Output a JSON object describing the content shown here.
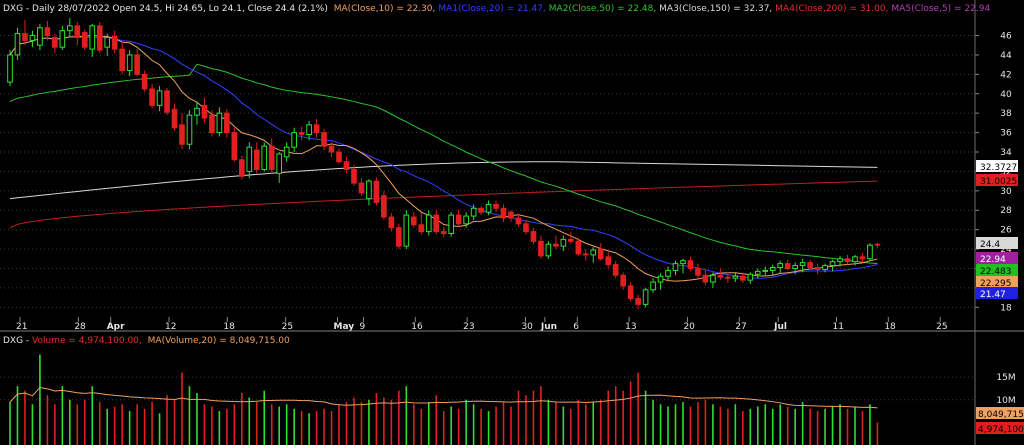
{
  "price_header": {
    "ticker_line": "DXG - Daily 28/07/2022 Open 24.5, Hi 24.65, Lo 24.1, Close 24.4 (2.1%)",
    "ma_items": [
      {
        "text": "MA(Close,10) = 22.30,",
        "color": "#f0a060"
      },
      {
        "text": "MA1(Close,20) = 21.47,",
        "color": "#3340ff"
      },
      {
        "text": "MA2(Close,50) = 22.48,",
        "color": "#30c030"
      },
      {
        "text": "MA3(Close,150) = 32.37,",
        "color": "#d8d8d8"
      },
      {
        "text": "MA4(Close,200) = 31.00,",
        "color": "#e03030"
      },
      {
        "text": "MA5(Close,5) = 22.94",
        "color": "#b040b0"
      }
    ]
  },
  "volume_header": {
    "ticker": "DXG - ",
    "volume_text": "Volume = 4,974,100.00,",
    "ma_text": "MA(Volume,20) = 8,049,715.00"
  },
  "price_axis": {
    "ticks": [
      "46",
      "44",
      "42",
      "40",
      "38",
      "36",
      "34",
      "32",
      "30",
      "28",
      "26",
      "24",
      "22",
      "20",
      "18"
    ],
    "tags": [
      {
        "text": "32.3727",
        "bg": "#ffffff",
        "fg": "#000000"
      },
      {
        "text": "31.0025",
        "bg": "#e02020",
        "fg": "#000000"
      },
      {
        "text": "24.4",
        "bg": "#d9d9d9",
        "fg": "#000000"
      },
      {
        "text": "22.94",
        "bg": "#a020a0",
        "fg": "#ffffff"
      },
      {
        "text": "22.483",
        "bg": "#20c020",
        "fg": "#000000"
      },
      {
        "text": "22.295",
        "bg": "#f0a060",
        "fg": "#000000"
      },
      {
        "text": "21.47",
        "bg": "#2020e0",
        "fg": "#ffffff"
      }
    ]
  },
  "volume_axis": {
    "ticks": [
      "15M",
      "10M"
    ],
    "tags": [
      {
        "text": "8,049,715",
        "bg": "#f0a060",
        "fg": "#000000"
      },
      {
        "text": "4,974,100",
        "bg": "#e02020",
        "fg": "#000000"
      }
    ]
  },
  "x_axis": {
    "labels": [
      {
        "text": "21",
        "month": false
      },
      {
        "text": "28",
        "month": false
      },
      {
        "text": "Apr",
        "month": true
      },
      {
        "text": "12",
        "month": false
      },
      {
        "text": "18",
        "month": false
      },
      {
        "text": "25",
        "month": false
      },
      {
        "text": "May",
        "month": true
      },
      {
        "text": "9",
        "month": false
      },
      {
        "text": "16",
        "month": false
      },
      {
        "text": "23",
        "month": false
      },
      {
        "text": "30",
        "month": false
      },
      {
        "text": "Jun",
        "month": true
      },
      {
        "text": "6",
        "month": false
      },
      {
        "text": "13",
        "month": false
      },
      {
        "text": "20",
        "month": false
      },
      {
        "text": "27",
        "month": false
      },
      {
        "text": "Jul",
        "month": true
      },
      {
        "text": "11",
        "month": false
      },
      {
        "text": "18",
        "month": false
      },
      {
        "text": "25",
        "month": false
      }
    ]
  },
  "colors": {
    "background": "#000000",
    "up": "#30e030",
    "down": "#e02020",
    "grid": "#3a3a3a",
    "ma10": "#f0a060",
    "ma20": "#3340ff",
    "ma50": "#30c030",
    "ma150": "#d8d8d8",
    "ma200": "#c02020",
    "volume_ma": "#f0a060"
  },
  "chart_data": {
    "type": "candlestick",
    "ticker": "DXG",
    "ylim": [
      17,
      47.6
    ],
    "volume_ylim": [
      0,
      21000000
    ],
    "candles": [
      {
        "o": 41.2,
        "h": 44.5,
        "l": 40.8,
        "c": 44.0,
        "v": 9500000
      },
      {
        "o": 44.0,
        "h": 46.8,
        "l": 43.5,
        "c": 46.2,
        "v": 13000000
      },
      {
        "o": 46.2,
        "h": 47.6,
        "l": 45.0,
        "c": 45.5,
        "v": 12000000
      },
      {
        "o": 45.5,
        "h": 46.5,
        "l": 44.8,
        "c": 46.0,
        "v": 9000000
      },
      {
        "o": 45.0,
        "h": 47.2,
        "l": 44.5,
        "c": 46.8,
        "v": 20000000
      },
      {
        "o": 46.8,
        "h": 47.5,
        "l": 45.5,
        "c": 46.0,
        "v": 11000000
      },
      {
        "o": 45.8,
        "h": 46.2,
        "l": 44.2,
        "c": 44.8,
        "v": 9000000
      },
      {
        "o": 44.8,
        "h": 47.0,
        "l": 44.5,
        "c": 46.5,
        "v": 13000000
      },
      {
        "o": 46.5,
        "h": 47.8,
        "l": 45.8,
        "c": 47.0,
        "v": 10000000
      },
      {
        "o": 47.0,
        "h": 47.4,
        "l": 45.0,
        "c": 45.8,
        "v": 9000000
      },
      {
        "o": 46.3,
        "h": 46.6,
        "l": 44.5,
        "c": 44.8,
        "v": 10000000
      },
      {
        "o": 44.6,
        "h": 47.2,
        "l": 43.8,
        "c": 47.0,
        "v": 13000000
      },
      {
        "o": 47.0,
        "h": 47.4,
        "l": 44.2,
        "c": 44.5,
        "v": 9500000
      },
      {
        "o": 44.8,
        "h": 46.2,
        "l": 43.9,
        "c": 45.8,
        "v": 8000000
      },
      {
        "o": 45.9,
        "h": 46.5,
        "l": 44.2,
        "c": 44.6,
        "v": 8500000
      },
      {
        "o": 44.6,
        "h": 45.4,
        "l": 42.0,
        "c": 42.4,
        "v": 9000000
      },
      {
        "o": 42.4,
        "h": 44.5,
        "l": 41.8,
        "c": 44.0,
        "v": 7500000
      },
      {
        "o": 44.0,
        "h": 44.6,
        "l": 41.8,
        "c": 42.0,
        "v": 9000000
      },
      {
        "o": 42.0,
        "h": 42.4,
        "l": 40.2,
        "c": 40.5,
        "v": 8000000
      },
      {
        "o": 40.5,
        "h": 41.0,
        "l": 38.5,
        "c": 38.8,
        "v": 9500000
      },
      {
        "o": 38.8,
        "h": 40.8,
        "l": 38.2,
        "c": 40.3,
        "v": 7000000
      },
      {
        "o": 40.3,
        "h": 40.6,
        "l": 37.8,
        "c": 38.1,
        "v": 11000000
      },
      {
        "o": 38.4,
        "h": 39.0,
        "l": 36.2,
        "c": 36.5,
        "v": 10000000
      },
      {
        "o": 36.8,
        "h": 38.0,
        "l": 34.3,
        "c": 34.8,
        "v": 16000000
      },
      {
        "o": 34.8,
        "h": 38.3,
        "l": 34.3,
        "c": 37.8,
        "v": 13000000
      },
      {
        "o": 37.8,
        "h": 39.2,
        "l": 36.8,
        "c": 38.5,
        "v": 11500000
      },
      {
        "o": 38.8,
        "h": 39.6,
        "l": 37.0,
        "c": 37.5,
        "v": 9000000
      },
      {
        "o": 37.8,
        "h": 38.3,
        "l": 35.6,
        "c": 36.0,
        "v": 8500000
      },
      {
        "o": 36.0,
        "h": 38.6,
        "l": 35.6,
        "c": 38.0,
        "v": 7500000
      },
      {
        "o": 38.0,
        "h": 38.4,
        "l": 35.5,
        "c": 36.0,
        "v": 8000000
      },
      {
        "o": 36.0,
        "h": 36.5,
        "l": 33.0,
        "c": 33.2,
        "v": 9000000
      },
      {
        "o": 33.2,
        "h": 33.6,
        "l": 31.2,
        "c": 31.5,
        "v": 11500000
      },
      {
        "o": 32.0,
        "h": 35.0,
        "l": 31.3,
        "c": 34.5,
        "v": 10500000
      },
      {
        "o": 34.2,
        "h": 35.0,
        "l": 31.8,
        "c": 32.2,
        "v": 9500000
      },
      {
        "o": 32.2,
        "h": 35.0,
        "l": 32.0,
        "c": 34.6,
        "v": 12000000
      },
      {
        "o": 34.6,
        "h": 35.4,
        "l": 31.8,
        "c": 32.2,
        "v": 9000000
      },
      {
        "o": 31.8,
        "h": 34.0,
        "l": 30.8,
        "c": 33.8,
        "v": 8500000
      },
      {
        "o": 33.5,
        "h": 35.0,
        "l": 33.0,
        "c": 34.5,
        "v": 9000000
      },
      {
        "o": 34.5,
        "h": 36.5,
        "l": 34.0,
        "c": 36.0,
        "v": 8000000
      },
      {
        "o": 36.0,
        "h": 36.6,
        "l": 35.2,
        "c": 35.8,
        "v": 7500000
      },
      {
        "o": 35.8,
        "h": 37.2,
        "l": 35.2,
        "c": 36.8,
        "v": 7000000
      },
      {
        "o": 36.8,
        "h": 37.4,
        "l": 35.5,
        "c": 36.0,
        "v": 7500000
      },
      {
        "o": 36.0,
        "h": 36.4,
        "l": 34.2,
        "c": 34.6,
        "v": 8000000
      },
      {
        "o": 34.6,
        "h": 35.0,
        "l": 33.5,
        "c": 34.0,
        "v": 7500000
      },
      {
        "o": 34.0,
        "h": 34.4,
        "l": 32.8,
        "c": 33.0,
        "v": 9000000
      },
      {
        "o": 33.0,
        "h": 33.5,
        "l": 31.8,
        "c": 32.2,
        "v": 9500000
      },
      {
        "o": 32.2,
        "h": 32.7,
        "l": 30.5,
        "c": 30.8,
        "v": 10500000
      },
      {
        "o": 30.8,
        "h": 31.3,
        "l": 29.5,
        "c": 29.8,
        "v": 9500000
      },
      {
        "o": 29.2,
        "h": 31.2,
        "l": 28.5,
        "c": 31.0,
        "v": 10000000
      },
      {
        "o": 31.0,
        "h": 31.4,
        "l": 28.5,
        "c": 28.8,
        "v": 11500000
      },
      {
        "o": 29.5,
        "h": 30.0,
        "l": 27.0,
        "c": 27.3,
        "v": 10500000
      },
      {
        "o": 27.3,
        "h": 27.7,
        "l": 25.8,
        "c": 26.2,
        "v": 10000000
      },
      {
        "o": 26.2,
        "h": 26.6,
        "l": 24.0,
        "c": 24.3,
        "v": 12000000
      },
      {
        "o": 24.3,
        "h": 28.0,
        "l": 24.0,
        "c": 27.5,
        "v": 13000000
      },
      {
        "o": 27.3,
        "h": 27.8,
        "l": 26.2,
        "c": 26.5,
        "v": 9000000
      },
      {
        "o": 26.5,
        "h": 27.7,
        "l": 25.5,
        "c": 25.8,
        "v": 8000000
      },
      {
        "o": 25.8,
        "h": 28.0,
        "l": 25.4,
        "c": 27.5,
        "v": 9500000
      },
      {
        "o": 27.5,
        "h": 28.0,
        "l": 25.5,
        "c": 25.8,
        "v": 11000000
      },
      {
        "o": 25.8,
        "h": 26.3,
        "l": 25.2,
        "c": 25.6,
        "v": 7500000
      },
      {
        "o": 25.6,
        "h": 27.8,
        "l": 25.3,
        "c": 27.5,
        "v": 8500000
      },
      {
        "o": 27.5,
        "h": 28.1,
        "l": 26.3,
        "c": 26.6,
        "v": 8000000
      },
      {
        "o": 26.6,
        "h": 27.8,
        "l": 26.2,
        "c": 27.4,
        "v": 10000000
      },
      {
        "o": 27.4,
        "h": 28.6,
        "l": 27.0,
        "c": 28.2,
        "v": 9000000
      },
      {
        "o": 28.2,
        "h": 28.4,
        "l": 27.5,
        "c": 27.8,
        "v": 8000000
      },
      {
        "o": 27.8,
        "h": 29.0,
        "l": 27.5,
        "c": 28.6,
        "v": 7500000
      },
      {
        "o": 28.6,
        "h": 29.0,
        "l": 27.8,
        "c": 28.2,
        "v": 8500000
      },
      {
        "o": 28.2,
        "h": 28.6,
        "l": 26.8,
        "c": 27.2,
        "v": 9500000
      },
      {
        "o": 27.8,
        "h": 28.0,
        "l": 26.8,
        "c": 27.2,
        "v": 8500000
      },
      {
        "o": 27.2,
        "h": 27.6,
        "l": 26.3,
        "c": 26.6,
        "v": 12000000
      },
      {
        "o": 26.6,
        "h": 27.0,
        "l": 25.5,
        "c": 25.8,
        "v": 11000000
      },
      {
        "o": 25.8,
        "h": 26.2,
        "l": 24.5,
        "c": 24.8,
        "v": 12000000
      },
      {
        "o": 24.8,
        "h": 25.4,
        "l": 23.0,
        "c": 23.3,
        "v": 13000000
      },
      {
        "o": 23.3,
        "h": 24.8,
        "l": 23.0,
        "c": 24.5,
        "v": 10000000
      },
      {
        "o": 24.5,
        "h": 25.4,
        "l": 24.0,
        "c": 24.3,
        "v": 9500000
      },
      {
        "o": 24.3,
        "h": 25.4,
        "l": 23.8,
        "c": 25.0,
        "v": 8500000
      },
      {
        "o": 25.0,
        "h": 25.8,
        "l": 24.5,
        "c": 24.8,
        "v": 8000000
      },
      {
        "o": 24.8,
        "h": 25.2,
        "l": 23.3,
        "c": 23.5,
        "v": 10000000
      },
      {
        "o": 23.5,
        "h": 24.0,
        "l": 22.8,
        "c": 23.4,
        "v": 9000000
      },
      {
        "o": 23.4,
        "h": 24.2,
        "l": 22.6,
        "c": 23.9,
        "v": 9500000
      },
      {
        "o": 24.0,
        "h": 24.6,
        "l": 22.8,
        "c": 23.0,
        "v": 10000000
      },
      {
        "o": 23.2,
        "h": 23.7,
        "l": 22.0,
        "c": 22.4,
        "v": 12000000
      },
      {
        "o": 22.4,
        "h": 22.8,
        "l": 21.0,
        "c": 21.3,
        "v": 13000000
      },
      {
        "o": 21.3,
        "h": 21.6,
        "l": 19.8,
        "c": 20.2,
        "v": 12000000
      },
      {
        "o": 20.2,
        "h": 20.6,
        "l": 18.6,
        "c": 18.9,
        "v": 14000000
      },
      {
        "o": 18.9,
        "h": 19.3,
        "l": 17.8,
        "c": 18.3,
        "v": 16000000
      },
      {
        "o": 18.3,
        "h": 20.0,
        "l": 18.0,
        "c": 19.8,
        "v": 12000000
      },
      {
        "o": 19.8,
        "h": 21.0,
        "l": 19.5,
        "c": 20.6,
        "v": 10000000
      },
      {
        "o": 20.6,
        "h": 21.5,
        "l": 19.8,
        "c": 21.2,
        "v": 9000000
      },
      {
        "o": 21.2,
        "h": 22.2,
        "l": 20.8,
        "c": 21.8,
        "v": 8500000
      },
      {
        "o": 21.8,
        "h": 22.8,
        "l": 21.3,
        "c": 22.5,
        "v": 9000000
      },
      {
        "o": 22.5,
        "h": 23.0,
        "l": 21.5,
        "c": 22.8,
        "v": 9500000
      },
      {
        "o": 22.8,
        "h": 23.2,
        "l": 21.7,
        "c": 22.0,
        "v": 8500000
      },
      {
        "o": 22.0,
        "h": 22.5,
        "l": 21.0,
        "c": 21.3,
        "v": 9500000
      },
      {
        "o": 21.3,
        "h": 21.8,
        "l": 20.3,
        "c": 20.6,
        "v": 10000000
      },
      {
        "o": 20.6,
        "h": 21.6,
        "l": 20.0,
        "c": 21.3,
        "v": 9000000
      },
      {
        "o": 21.3,
        "h": 22.0,
        "l": 20.8,
        "c": 21.1,
        "v": 8500000
      },
      {
        "o": 21.1,
        "h": 21.6,
        "l": 20.5,
        "c": 21.0,
        "v": 8000000
      },
      {
        "o": 21.0,
        "h": 21.6,
        "l": 20.6,
        "c": 21.2,
        "v": 9000000
      },
      {
        "o": 21.2,
        "h": 21.5,
        "l": 20.5,
        "c": 20.8,
        "v": 7500000
      },
      {
        "o": 20.8,
        "h": 21.6,
        "l": 20.4,
        "c": 21.4,
        "v": 8000000
      },
      {
        "o": 21.4,
        "h": 22.0,
        "l": 21.0,
        "c": 21.7,
        "v": 8500000
      },
      {
        "o": 21.7,
        "h": 22.2,
        "l": 21.2,
        "c": 21.8,
        "v": 9000000
      },
      {
        "o": 21.8,
        "h": 22.4,
        "l": 21.3,
        "c": 22.1,
        "v": 8000000
      },
      {
        "o": 22.1,
        "h": 22.8,
        "l": 21.5,
        "c": 22.5,
        "v": 9000000
      },
      {
        "o": 22.5,
        "h": 22.9,
        "l": 21.8,
        "c": 22.0,
        "v": 8500000
      },
      {
        "o": 22.0,
        "h": 22.6,
        "l": 21.4,
        "c": 22.3,
        "v": 8000000
      },
      {
        "o": 22.3,
        "h": 23.0,
        "l": 21.6,
        "c": 22.6,
        "v": 9500000
      },
      {
        "o": 22.6,
        "h": 22.9,
        "l": 21.9,
        "c": 22.1,
        "v": 8000000
      },
      {
        "o": 22.1,
        "h": 22.5,
        "l": 21.4,
        "c": 21.9,
        "v": 7500000
      },
      {
        "o": 21.9,
        "h": 22.5,
        "l": 21.6,
        "c": 22.3,
        "v": 8000000
      },
      {
        "o": 22.3,
        "h": 22.9,
        "l": 21.7,
        "c": 22.7,
        "v": 8500000
      },
      {
        "o": 22.7,
        "h": 23.3,
        "l": 22.2,
        "c": 23.0,
        "v": 9000000
      },
      {
        "o": 23.0,
        "h": 23.4,
        "l": 22.4,
        "c": 22.7,
        "v": 8000000
      },
      {
        "o": 22.7,
        "h": 23.4,
        "l": 22.3,
        "c": 23.2,
        "v": 8500000
      },
      {
        "o": 23.2,
        "h": 23.6,
        "l": 22.6,
        "c": 23.0,
        "v": 7500000
      },
      {
        "o": 23.0,
        "h": 24.6,
        "l": 22.8,
        "c": 24.4,
        "v": 9000000
      },
      {
        "o": 24.5,
        "h": 24.65,
        "l": 24.1,
        "c": 24.4,
        "v": 4974100
      }
    ]
  }
}
